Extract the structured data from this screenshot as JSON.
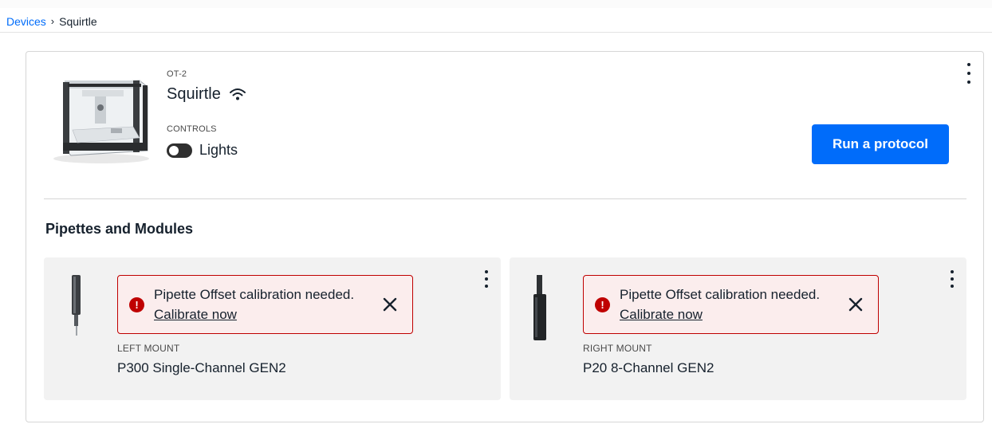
{
  "breadcrumb": {
    "parent": "Devices",
    "separator": "›",
    "current": "Squirtle"
  },
  "robot": {
    "model": "OT-2",
    "name": "Squirtle",
    "controls_label": "CONTROLS",
    "lights_label": "Lights",
    "lights_on": false,
    "run_button": "Run a protocol"
  },
  "section": {
    "title": "Pipettes and Modules"
  },
  "pipettes": [
    {
      "alert_text": "Pipette Offset calibration needed.",
      "alert_link": "Calibrate now",
      "mount": "LEFT MOUNT",
      "name": "P300 Single-Channel GEN2"
    },
    {
      "alert_text": "Pipette Offset calibration needed.",
      "alert_link": "Calibrate now",
      "mount": "RIGHT MOUNT",
      "name": "P20 8-Channel GEN2"
    }
  ],
  "colors": {
    "primary": "#006cfa",
    "error": "#bf0000",
    "error_bg": "#fbeded",
    "card_bg": "#f2f2f2"
  },
  "icons": [
    "wifi-icon",
    "toggle-off-icon",
    "kebab-menu-icon",
    "alert-circle-icon",
    "close-icon"
  ]
}
